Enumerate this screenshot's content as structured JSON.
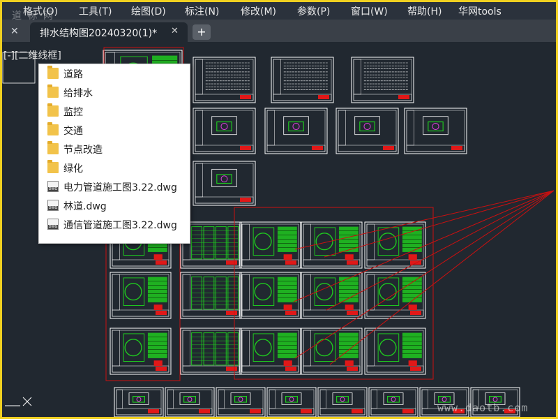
{
  "menu": {
    "items": [
      "格式(O)",
      "工具(T)",
      "绘图(D)",
      "标注(N)",
      "修改(M)",
      "参数(P)",
      "窗口(W)",
      "帮助(H)",
      "华网tools"
    ]
  },
  "tabs": {
    "active_label": "排水结构图20240320(1)*",
    "new_tab_label": "+"
  },
  "viewport": {
    "label": "[-][二维线框]"
  },
  "dropdown": {
    "items": [
      {
        "icon": "folder-icon",
        "label": "道路"
      },
      {
        "icon": "folder-icon",
        "label": "给排水"
      },
      {
        "icon": "folder-icon",
        "label": "监控"
      },
      {
        "icon": "folder-icon",
        "label": "交通"
      },
      {
        "icon": "folder-icon",
        "label": "节点改造"
      },
      {
        "icon": "folder-icon",
        "label": "绿化"
      },
      {
        "icon": "dwg-icon",
        "label": "电力管道施工图3.22.dwg"
      },
      {
        "icon": "dwg-icon",
        "label": "林道.dwg"
      },
      {
        "icon": "dwg-icon",
        "label": "通信管道施工图3.22.dwg"
      }
    ]
  },
  "watermarks": {
    "top": "道 标 网",
    "bottom": "www.daotb.com"
  },
  "colors": {
    "canvas_bg": "#212830",
    "border": "#f0d020",
    "drawing_line": "#ffffff",
    "drawing_fill": "#1fc81f",
    "highlight": "#cc1010",
    "title_block_red": "#e01818"
  }
}
